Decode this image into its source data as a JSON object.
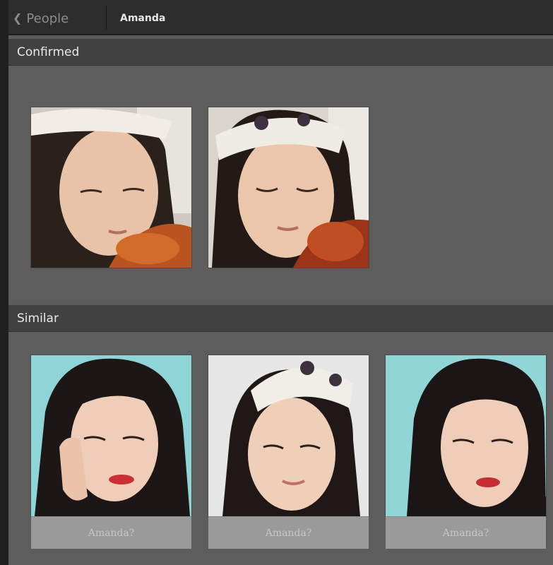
{
  "nav": {
    "back_label": "People",
    "title": "Amanda"
  },
  "sections": {
    "confirmed": {
      "title": "Confirmed",
      "photos": [
        {
          "icon": "portrait-violin-headband-1"
        },
        {
          "icon": "portrait-violin-headband-2"
        }
      ]
    },
    "similar": {
      "title": "Similar",
      "items": [
        {
          "icon": "portrait-hand-on-cheek",
          "placeholder": "Amanda?"
        },
        {
          "icon": "portrait-headband-smile",
          "placeholder": "Amanda?"
        },
        {
          "icon": "portrait-red-lips",
          "placeholder": "Amanda?"
        }
      ]
    }
  },
  "colors": {
    "topbar": "#2d2d2d",
    "section_header": "#414141",
    "panel": "#5d5d5d",
    "name_box": "#9a9a9a",
    "teal_backdrop": "#8fd4d6"
  }
}
